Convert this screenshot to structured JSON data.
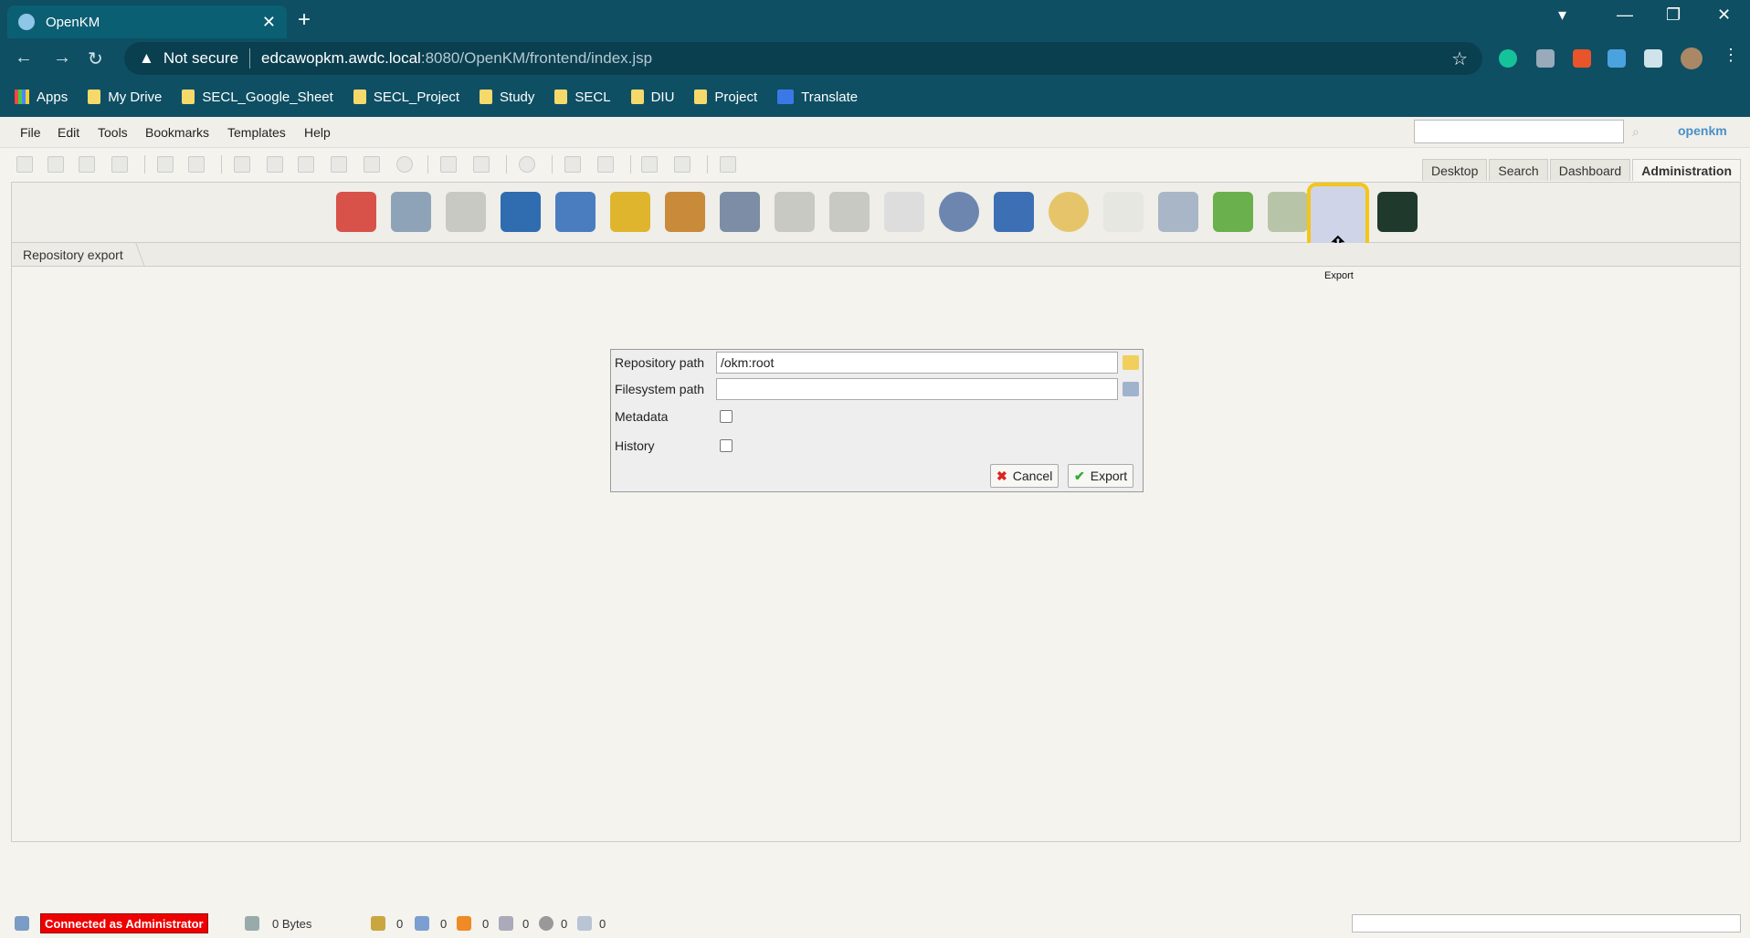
{
  "browser": {
    "tab_title": "OpenKM",
    "tab_close": "✕",
    "new_tab": "+",
    "security": "Not secure",
    "url_host": "edcawopkm.awdc.local",
    "url_path": ":8080/OpenKM/frontend/index.jsp",
    "bookmarks": [
      "Apps",
      "My Drive",
      "SECL_Google_Sheet",
      "SECL_Project",
      "Study",
      "SECL",
      "DIU",
      "Project",
      "Translate"
    ]
  },
  "app": {
    "menu": [
      "File",
      "Edit",
      "Tools",
      "Bookmarks",
      "Templates",
      "Help"
    ],
    "logo": "openkm",
    "workspace_tabs": [
      "Desktop",
      "Search",
      "Dashboard",
      "Administration"
    ],
    "active_tab": "Administration",
    "tooltip": "Export",
    "breadcrumb": "Repository export",
    "form": {
      "repo_label": "Repository path",
      "repo_value": "/okm:root",
      "fs_label": "Filesystem path",
      "fs_value": "",
      "metadata_label": "Metadata",
      "history_label": "History",
      "cancel": "Cancel",
      "export": "Export"
    },
    "status": {
      "connected": "Connected as Administrator",
      "size": "0 Bytes",
      "counts": [
        "0",
        "0",
        "0",
        "0",
        "0",
        "0"
      ]
    }
  }
}
